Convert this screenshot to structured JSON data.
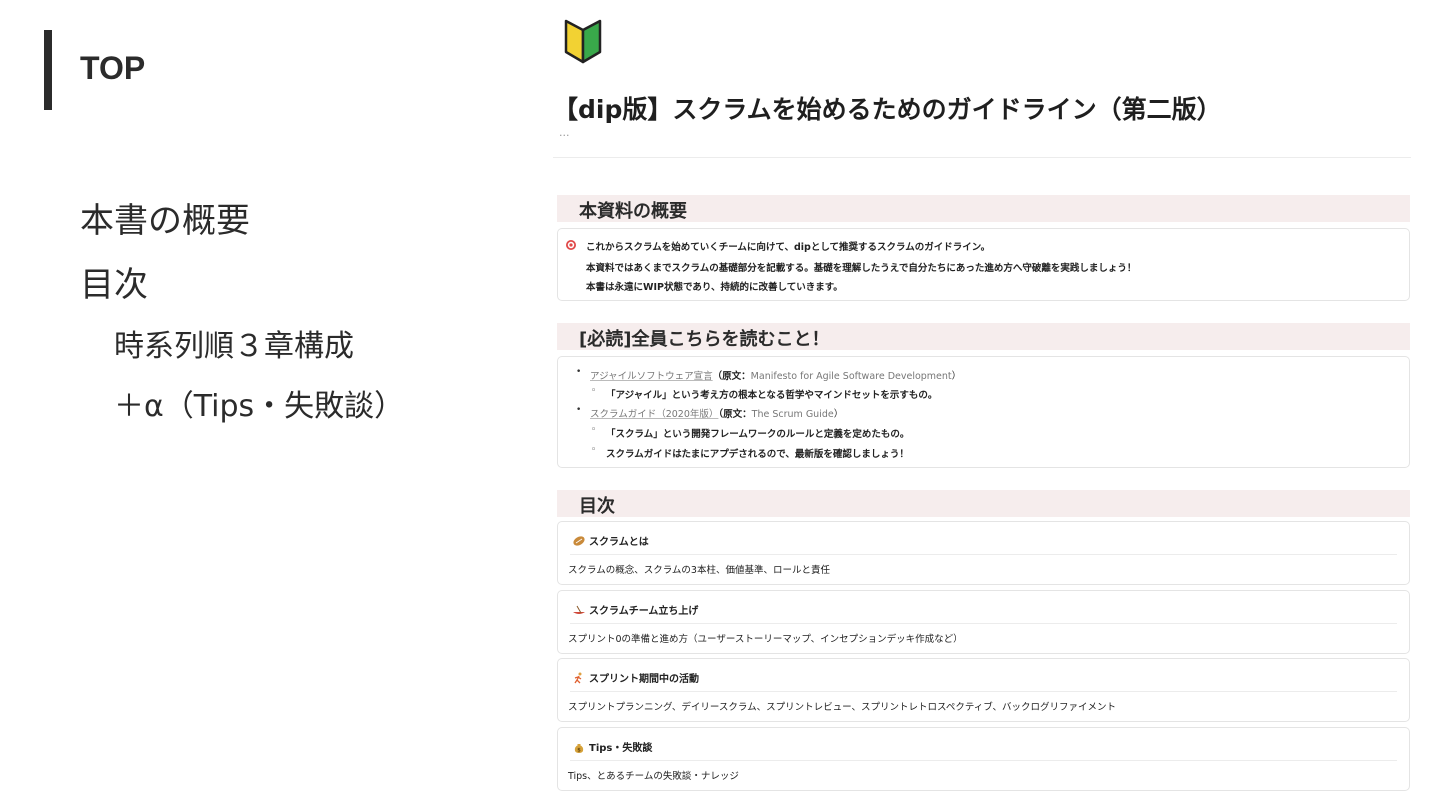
{
  "slide": {
    "title": "TOP",
    "outline": [
      {
        "label": "本書の概要",
        "level": 1
      },
      {
        "label": "目次",
        "level": 1
      },
      {
        "label": "時系列順３章構成",
        "level": 2
      },
      {
        "label": "＋α（Tips・失敗談）",
        "level": 2
      }
    ]
  },
  "page": {
    "icon": "beginner-mark-icon",
    "title": "【dip版】スクラムを始めるためのガイドライン（第二版）",
    "ellipsis": "...",
    "sections": {
      "overview": {
        "heading": "本資料の概要",
        "icon": "target-icon",
        "lines": [
          "これからスクラムを始めていくチームに向けて、dipとして推奨するスクラムのガイドライン。",
          "本資料ではあくまでスクラムの基礎部分を記載する。基礎を理解したうえで自分たちにあった進め方へ守破離を実践しましょう！",
          "本書は永遠にWIP状態であり、持続的に改善していきます。"
        ]
      },
      "required": {
        "heading": "[必読]全員こちらを読むこと！",
        "items": [
          {
            "link": "アジャイルソフトウェア宣言",
            "original_prefix": "（原文：",
            "original_link": "Manifesto for Agile Software Development",
            "original_suffix": "）",
            "sub": [
              "「アジャイル」という考え方の根本となる哲学やマインドセットを示すもの。"
            ]
          },
          {
            "link": "スクラムガイド（2020年版）",
            "original_prefix": "（原文：",
            "original_link": "The Scrum Guide",
            "original_suffix": "）",
            "sub": [
              "「スクラム」という開発フレームワークのルールと定義を定めたもの。",
              "スクラムガイドはたまにアプデされるので、最新版を確認しましょう！"
            ]
          }
        ]
      },
      "toc": {
        "heading": "目次",
        "cards": [
          {
            "icon": "rugby-ball-icon",
            "title": "スクラムとは",
            "desc": "スクラムの概念、スクラムの3本柱、価値基準、ロールと責任"
          },
          {
            "icon": "canoe-icon",
            "title": "スクラムチーム立ち上げ",
            "desc": "スプリント0の準備と進め方（ユーザーストーリーマップ、インセプションデッキ作成など）"
          },
          {
            "icon": "runner-icon",
            "title": "スプリント期間中の活動",
            "desc": "スプリントプランニング、デイリースクラム、スプリントレビュー、スプリントレトロスペクティブ、バックログリファイメント"
          },
          {
            "icon": "money-bag-icon",
            "title": "Tips・失敗談",
            "desc": "Tips、とあるチームの失敗談・ナレッジ"
          }
        ]
      }
    }
  }
}
